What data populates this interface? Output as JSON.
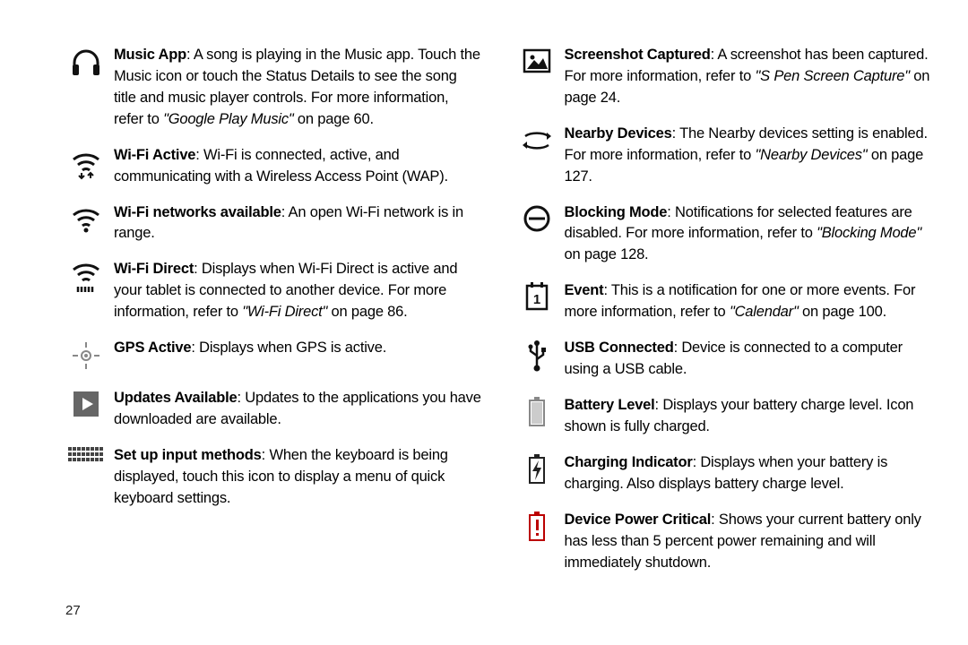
{
  "page_number": "27",
  "left_column": [
    {
      "icon": "headphones",
      "bold": "Music App",
      "text": ": A song is playing in the Music app. Touch the Music icon or touch the Status Details to see the song title and music player controls. For more information, refer to ",
      "ref_italic": "\"Google Play Music\"",
      "ref_after": " on page 60."
    },
    {
      "icon": "wifi-active",
      "bold": "Wi-Fi Active",
      "text": ": Wi-Fi is connected, active, and communicating with a Wireless Access Point (WAP).",
      "ref_italic": "",
      "ref_after": ""
    },
    {
      "icon": "wifi-available",
      "bold": "Wi-Fi networks available",
      "text": ": An open Wi-Fi network is in range.",
      "ref_italic": "",
      "ref_after": ""
    },
    {
      "icon": "wifi-direct",
      "bold": "Wi-Fi Direct",
      "text": ": Displays when Wi-Fi Direct is active and your tablet is connected to another device. For more information, refer to ",
      "ref_italic": "\"Wi-Fi Direct\"",
      "ref_after": " on page 86."
    },
    {
      "icon": "gps",
      "bold": "GPS Active",
      "text": ": Displays when GPS is active.",
      "ref_italic": "",
      "ref_after": ""
    },
    {
      "icon": "updates",
      "bold": "Updates Available",
      "text": ": Updates to the applications you have downloaded are available.",
      "ref_italic": "",
      "ref_after": ""
    },
    {
      "icon": "keyboard",
      "bold": "Set up input methods",
      "text": ": When the keyboard is being displayed, touch this icon to display a menu of quick keyboard settings.",
      "ref_italic": "",
      "ref_after": ""
    }
  ],
  "right_column": [
    {
      "icon": "screenshot",
      "bold": "Screenshot Captured",
      "text": ": A screenshot has been captured. For more information, refer to ",
      "ref_italic": "\"S Pen Screen Capture\"",
      "ref_after": " on page 24."
    },
    {
      "icon": "nearby",
      "bold": "Nearby Devices",
      "text": ": The Nearby devices setting is enabled. For more information, refer to ",
      "ref_italic": "\"Nearby Devices\"",
      "ref_after": " on page 127."
    },
    {
      "icon": "blocking",
      "bold": "Blocking Mode",
      "text": ": Notifications for selected features are disabled. For more information, refer to ",
      "ref_italic": "\"Blocking Mode\"",
      "ref_after": " on page 128."
    },
    {
      "icon": "event",
      "bold": "Event",
      "text": ": This is a notification for one or more events. For more information, refer to ",
      "ref_italic": "\"Calendar\"",
      "ref_after": " on page 100."
    },
    {
      "icon": "usb",
      "bold": "USB Connected",
      "text": ": Device is connected to a computer using a USB cable.",
      "ref_italic": "",
      "ref_after": ""
    },
    {
      "icon": "battery",
      "bold": "Battery Level",
      "text": ": Displays your battery charge level. Icon shown is fully charged.",
      "ref_italic": "",
      "ref_after": ""
    },
    {
      "icon": "charging",
      "bold": "Charging Indicator",
      "text": ": Displays when your battery is charging. Also displays battery charge level.",
      "ref_italic": "",
      "ref_after": ""
    },
    {
      "icon": "critical",
      "bold": "Device Power Critical",
      "text": ": Shows your current battery only has less than 5 percent power remaining and will immediately shutdown.",
      "ref_italic": "",
      "ref_after": ""
    }
  ],
  "event_number": "1"
}
